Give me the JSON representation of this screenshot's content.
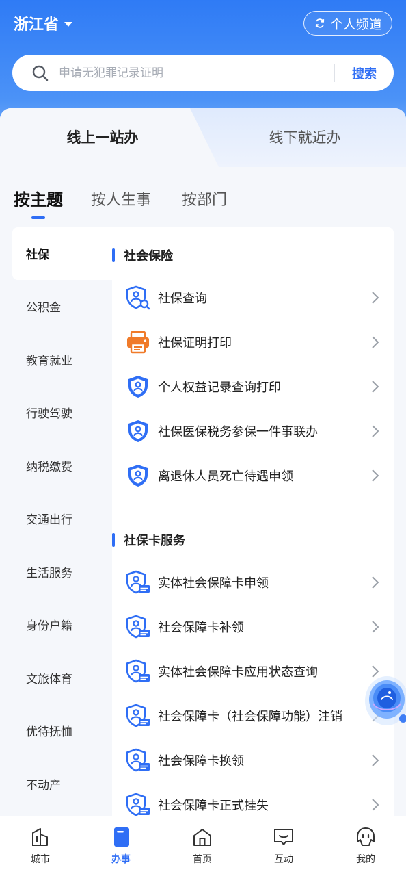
{
  "header": {
    "region": "浙江省",
    "channel_button": "个人频道"
  },
  "search": {
    "placeholder": "申请无犯罪记录证明",
    "button": "搜索"
  },
  "mode_tabs": {
    "active": "线上一站办",
    "inactive": "线下就近办"
  },
  "category_tabs": [
    "按主题",
    "按人生事",
    "按部门"
  ],
  "sidebar": {
    "items": [
      "社保",
      "公积金",
      "教育就业",
      "行驶驾驶",
      "纳税缴费",
      "交通出行",
      "生活服务",
      "身份户籍",
      "文旅体育",
      "优待抚恤",
      "不动产"
    ]
  },
  "sections": [
    {
      "title": "社会保险",
      "items": [
        "社保查询",
        "社保证明打印",
        "个人权益记录查询打印",
        "社保医保税务参保一件事联办",
        "离退休人员死亡待遇申领"
      ]
    },
    {
      "title": "社保卡服务",
      "items": [
        "实体社会保障卡申领",
        "社会保障卡补领",
        "实体社会保障卡应用状态查询",
        "社会保障卡（社会保障功能）注销",
        "社会保障卡换领",
        "社会保障卡正式挂失"
      ]
    }
  ],
  "bottom_nav": [
    "城市",
    "办事",
    "首页",
    "互动",
    "我的"
  ],
  "colors": {
    "accent": "#2f6ef5",
    "header_top": "#2f7bf5",
    "print_icon": "#f07b2a"
  }
}
